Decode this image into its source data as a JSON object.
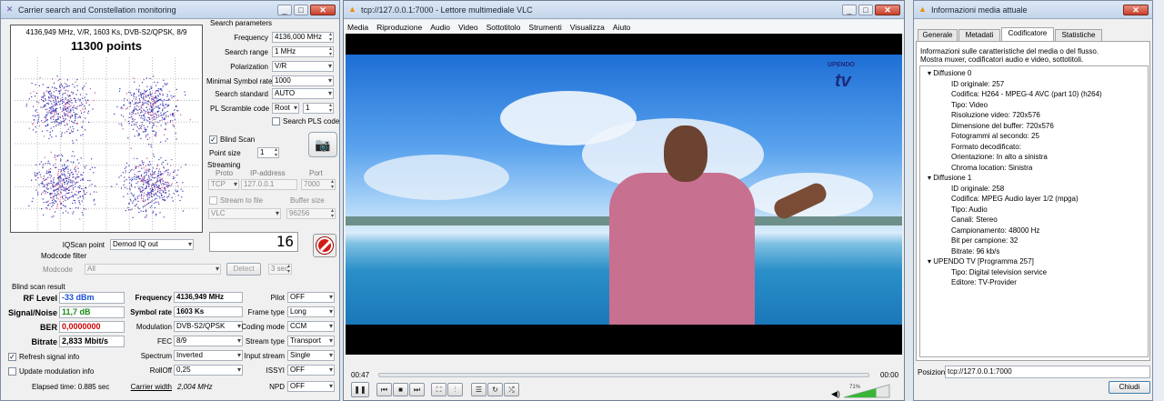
{
  "carrier": {
    "title": "Carrier search and Constellation monitoring",
    "info_line": "4136,949 MHz, V/R, 1603 Ks, DVB-S2/QPSK, 8/9",
    "points": "11300 points",
    "search_params": {
      "header": "Search parameters",
      "frequency_label": "Frequency",
      "frequency_value": "4136,000 MHz",
      "search_range_label": "Search range",
      "search_range_value": "1 MHz",
      "polarization_label": "Polarization",
      "polarization_value": "V/R",
      "min_sr_label": "Minimal Symbol rate",
      "min_sr_value": "1000",
      "search_std_label": "Search standard",
      "search_std_value": "AUTO",
      "pls_label": "PL Scramble code",
      "pls_mode": "Root",
      "pls_value": "1",
      "search_pls_label": "Search PLS code",
      "blind_scan_label": "Blind Scan",
      "point_size_label": "Point size",
      "point_size_value": "1"
    },
    "streaming": {
      "header": "Streaming",
      "proto_label": "Proto",
      "ip_label": "IP-address",
      "port_label": "Port",
      "proto_value": "TCP",
      "ip_value": "127.0.0.1",
      "port_value": "7000",
      "stream_file_label": "Stream to file",
      "buffer_label": "Buffer size",
      "player_value": "VLC",
      "buffer_value": "96256"
    },
    "iqscan_label": "IQScan point",
    "iqscan_value": "Demod IQ out",
    "counter": "16",
    "modcode_filter_label": "Modcode filter",
    "modcode_label": "Modcode",
    "modcode_value": "All",
    "detect_label": "Detect",
    "detect_time": "3 sec",
    "result": {
      "header": "Blind scan result",
      "rf_label": "RF Level",
      "rf_value": "-33 dBm",
      "sn_label": "Signal/Noise",
      "sn_value": "11,7 dB",
      "ber_label": "BER",
      "ber_value": "0,0000000",
      "bitrate_label": "Bitrate",
      "bitrate_value": "2,833 Mbit/s",
      "freq_label": "Frequency",
      "freq_value": "4136,949 MHz",
      "sr_label": "Symbol rate",
      "sr_value": "1603 Ks",
      "mod_label": "Modulation",
      "mod_value": "DVB-S2/QPSK",
      "fec_label": "FEC",
      "fec_value": "8/9",
      "spectrum_label": "Spectrum",
      "spectrum_value": "Inverted",
      "rolloff_label": "RollOff",
      "rolloff_value": "0,25",
      "cw_label": "Carrier width",
      "cw_value": "2,004 MHz",
      "pilot_label": "Pilot",
      "pilot_value": "OFF",
      "frame_label": "Frame type",
      "frame_value": "Long",
      "coding_label": "Coding mode",
      "coding_value": "CCM",
      "stype_label": "Stream type",
      "stype_value": "Transport",
      "istream_label": "Input stream",
      "istream_value": "Single",
      "issyi_label": "ISSYI",
      "issyi_value": "OFF",
      "npd_label": "NPD",
      "npd_value": "OFF",
      "refresh_label": "Refresh signal info",
      "update_mod_label": "Update modulation info",
      "elapsed": "Elapsed time: 0.885 sec"
    }
  },
  "vlc": {
    "title": "tcp://127.0.0.1:7000 - Lettore multimediale VLC",
    "menu": [
      "Media",
      "Riproduzione",
      "Audio",
      "Video",
      "Sottotitolo",
      "Strumenti",
      "Visualizza",
      "Aiuto"
    ],
    "time_elapsed": "00:47",
    "time_total": "00:00",
    "volume": "71%",
    "logo_text": "UPENDO"
  },
  "info": {
    "title": "Informazioni media attuale",
    "tabs": [
      "Generale",
      "Metadati",
      "Codificatore",
      "Statistiche"
    ],
    "desc1": "Informazioni sulle caratteristiche del media o del flusso.",
    "desc2": "Mostra muxer, codificatori audio e video, sottotitoli.",
    "tree": [
      {
        "t": "Diffusione 0",
        "l": 0
      },
      {
        "t": "ID originale: 257",
        "l": 1
      },
      {
        "t": "Codifica: H264 - MPEG-4 AVC (part 10) (h264)",
        "l": 1
      },
      {
        "t": "Tipo: Video",
        "l": 1
      },
      {
        "t": "Risoluzione video: 720x576",
        "l": 1
      },
      {
        "t": "Dimensione del buffer: 720x576",
        "l": 1
      },
      {
        "t": "Fotogrammi al secondo: 25",
        "l": 1
      },
      {
        "t": "Formato decodificato:",
        "l": 1
      },
      {
        "t": "Orientazione: In alto a sinistra",
        "l": 1
      },
      {
        "t": "Chroma location: Sinistra",
        "l": 1
      },
      {
        "t": "Diffusione 1",
        "l": 0
      },
      {
        "t": "ID originale: 258",
        "l": 1
      },
      {
        "t": "Codifica: MPEG Audio layer 1/2 (mpga)",
        "l": 1
      },
      {
        "t": "Tipo: Audio",
        "l": 1
      },
      {
        "t": "Canali: Stereo",
        "l": 1
      },
      {
        "t": "Campionamento: 48000 Hz",
        "l": 1
      },
      {
        "t": "Bit per campione: 32",
        "l": 1
      },
      {
        "t": "Bitrate: 96 kb/s",
        "l": 1
      },
      {
        "t": "UPENDO TV [Programma 257]",
        "l": 0
      },
      {
        "t": "Tipo: Digital television service",
        "l": 1
      },
      {
        "t": "Editore: TV-Provider",
        "l": 1
      }
    ],
    "location_label": "Posizione:",
    "location_value": "tcp://127.0.0.1:7000",
    "close_label": "Chiudi"
  },
  "colors": {
    "rf": "#1a4fd0",
    "sn": "#1a8a1a",
    "ber": "#cc0000",
    "vlc_orange": "#f28a00"
  }
}
